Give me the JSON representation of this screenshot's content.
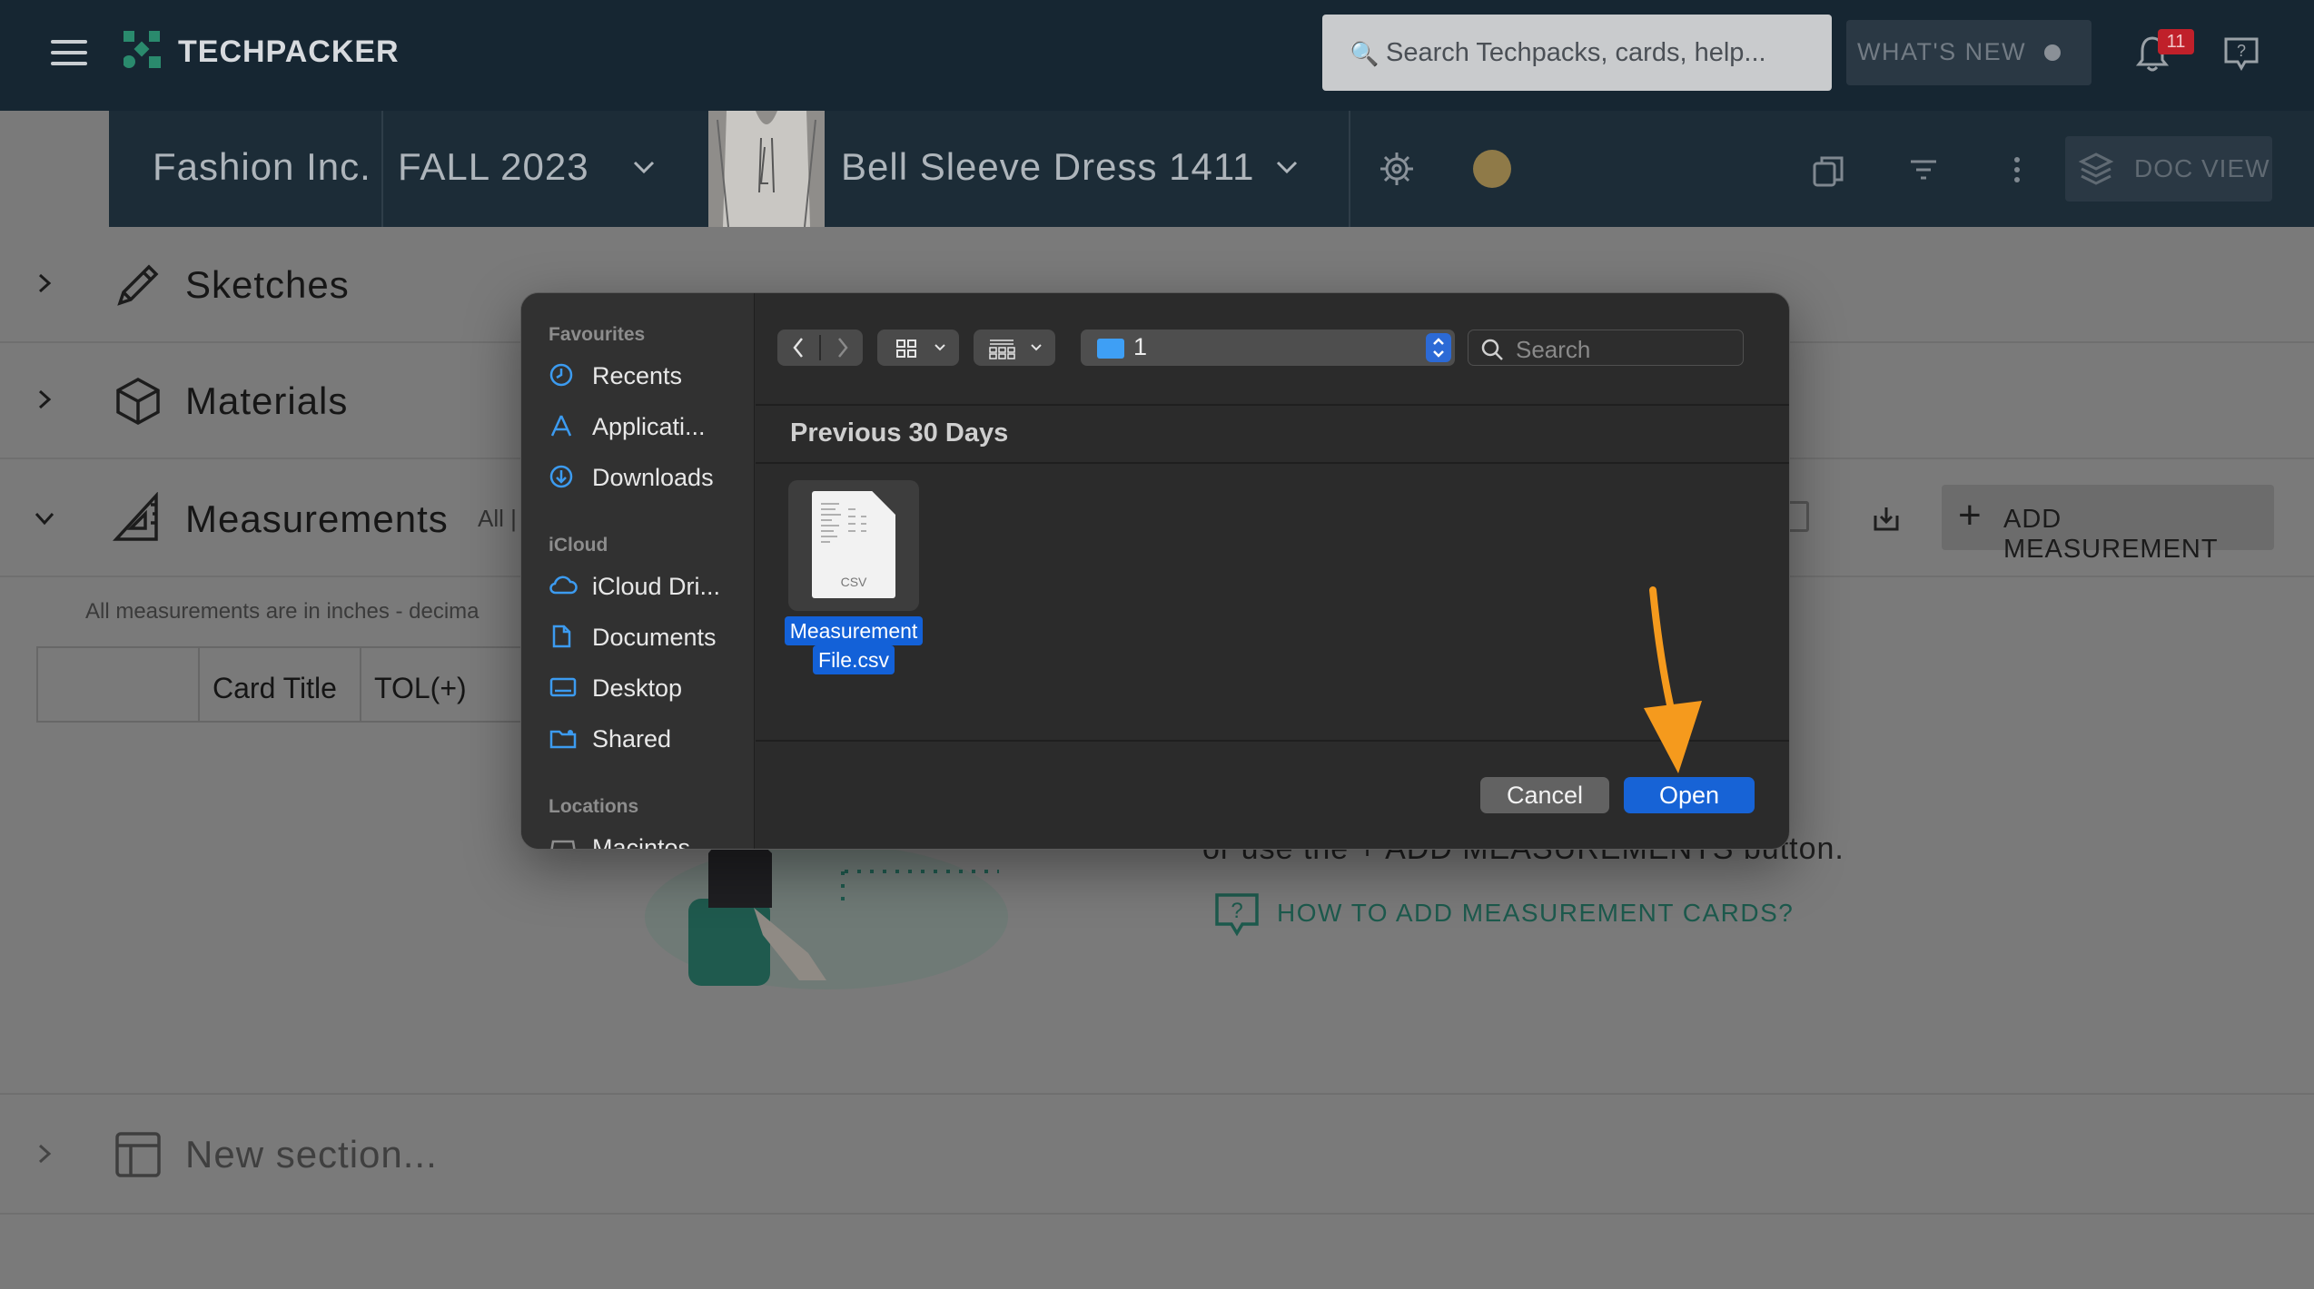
{
  "app": {
    "logo_text": "TECHPACKER",
    "search_placeholder": "Search Techpacks, cards, help...",
    "whats_new_label": "WHAT'S NEW",
    "notification_count": "11"
  },
  "context_bar": {
    "organization": "Fashion Inc.",
    "season": "FALL 2023",
    "product": "Bell Sleeve Dress 1411",
    "doc_view_label": "DOC VIEW",
    "status_color": "#8f7a48"
  },
  "sections": {
    "sketches": "Sketches",
    "materials": "Materials",
    "measurements": "Measurements",
    "measurements_filter": "All |",
    "units_note": "All measurements are in inches - decima",
    "table_headers": [
      "Card Title",
      "TOL(+)"
    ],
    "add_measurement_label": "ADD MEASUREMENT",
    "empty_hint": "or use the + ADD MEASUREMENTS button.",
    "how_to_link": "HOW TO ADD MEASUREMENT CARDS?",
    "new_section_placeholder": "New section..."
  },
  "dialog": {
    "sidebar": {
      "favourites_heading": "Favourites",
      "favourites": [
        {
          "label": "Recents",
          "icon": "clock-icon"
        },
        {
          "label": "Applicati...",
          "icon": "applications-icon"
        },
        {
          "label": "Downloads",
          "icon": "download-circle-icon"
        }
      ],
      "icloud_heading": "iCloud",
      "icloud": [
        {
          "label": "iCloud Dri...",
          "icon": "cloud-icon"
        },
        {
          "label": "Documents",
          "icon": "document-icon"
        },
        {
          "label": "Desktop",
          "icon": "desktop-icon"
        },
        {
          "label": "Shared",
          "icon": "shared-folder-icon"
        }
      ],
      "locations_heading": "Locations",
      "locations": [
        {
          "label": "Macintos...",
          "icon": "disk-icon"
        }
      ]
    },
    "current_folder": "1",
    "search_placeholder": "Search",
    "group_heading": "Previous 30 Days",
    "file": {
      "name_line1": "Measurement",
      "name_line2": "File.csv",
      "ext": "CSV"
    },
    "cancel_label": "Cancel",
    "open_label": "Open",
    "accent_color": "#1763d6"
  },
  "annotation": {
    "arrow_color": "#f59a1d"
  }
}
